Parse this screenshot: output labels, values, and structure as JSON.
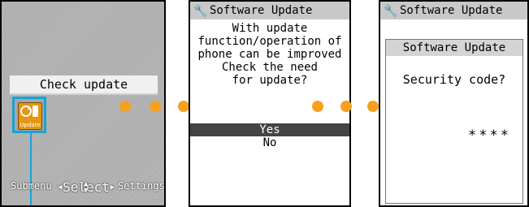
{
  "screen1": {
    "title": "Check update",
    "icon_label": "Update",
    "softkeys": {
      "left": "Submenu",
      "center": "Select",
      "right": "Settings"
    }
  },
  "screen2": {
    "title": "Software Update",
    "message_lines": [
      "With update",
      "function/operation of",
      "phone can be improved",
      "Check the need",
      "for update?"
    ],
    "options": [
      "Yes",
      "No"
    ],
    "selected_option": "Yes"
  },
  "screen3": {
    "title": "Software Update",
    "dialog_title": "Software Update",
    "label": "Security code?",
    "code": "****"
  },
  "colors": {
    "accent": "#f5a11f",
    "highlight": "#17a2d8"
  }
}
